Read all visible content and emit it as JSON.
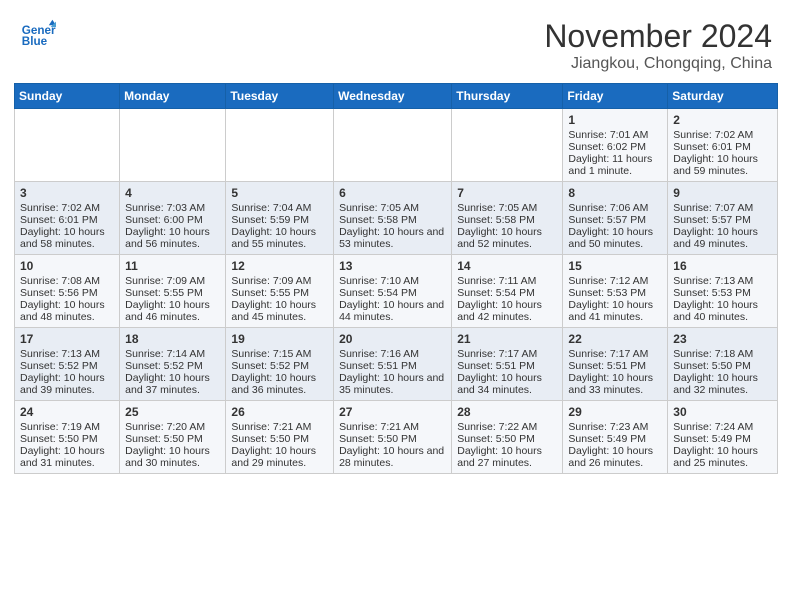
{
  "header": {
    "logo_line1": "General",
    "logo_line2": "Blue",
    "title": "November 2024",
    "subtitle": "Jiangkou, Chongqing, China"
  },
  "weekdays": [
    "Sunday",
    "Monday",
    "Tuesday",
    "Wednesday",
    "Thursday",
    "Friday",
    "Saturday"
  ],
  "weeks": [
    [
      {
        "day": "",
        "sunrise": "",
        "sunset": "",
        "daylight": ""
      },
      {
        "day": "",
        "sunrise": "",
        "sunset": "",
        "daylight": ""
      },
      {
        "day": "",
        "sunrise": "",
        "sunset": "",
        "daylight": ""
      },
      {
        "day": "",
        "sunrise": "",
        "sunset": "",
        "daylight": ""
      },
      {
        "day": "",
        "sunrise": "",
        "sunset": "",
        "daylight": ""
      },
      {
        "day": "1",
        "sunrise": "Sunrise: 7:01 AM",
        "sunset": "Sunset: 6:02 PM",
        "daylight": "Daylight: 11 hours and 1 minute."
      },
      {
        "day": "2",
        "sunrise": "Sunrise: 7:02 AM",
        "sunset": "Sunset: 6:01 PM",
        "daylight": "Daylight: 10 hours and 59 minutes."
      }
    ],
    [
      {
        "day": "3",
        "sunrise": "Sunrise: 7:02 AM",
        "sunset": "Sunset: 6:01 PM",
        "daylight": "Daylight: 10 hours and 58 minutes."
      },
      {
        "day": "4",
        "sunrise": "Sunrise: 7:03 AM",
        "sunset": "Sunset: 6:00 PM",
        "daylight": "Daylight: 10 hours and 56 minutes."
      },
      {
        "day": "5",
        "sunrise": "Sunrise: 7:04 AM",
        "sunset": "Sunset: 5:59 PM",
        "daylight": "Daylight: 10 hours and 55 minutes."
      },
      {
        "day": "6",
        "sunrise": "Sunrise: 7:05 AM",
        "sunset": "Sunset: 5:58 PM",
        "daylight": "Daylight: 10 hours and 53 minutes."
      },
      {
        "day": "7",
        "sunrise": "Sunrise: 7:05 AM",
        "sunset": "Sunset: 5:58 PM",
        "daylight": "Daylight: 10 hours and 52 minutes."
      },
      {
        "day": "8",
        "sunrise": "Sunrise: 7:06 AM",
        "sunset": "Sunset: 5:57 PM",
        "daylight": "Daylight: 10 hours and 50 minutes."
      },
      {
        "day": "9",
        "sunrise": "Sunrise: 7:07 AM",
        "sunset": "Sunset: 5:57 PM",
        "daylight": "Daylight: 10 hours and 49 minutes."
      }
    ],
    [
      {
        "day": "10",
        "sunrise": "Sunrise: 7:08 AM",
        "sunset": "Sunset: 5:56 PM",
        "daylight": "Daylight: 10 hours and 48 minutes."
      },
      {
        "day": "11",
        "sunrise": "Sunrise: 7:09 AM",
        "sunset": "Sunset: 5:55 PM",
        "daylight": "Daylight: 10 hours and 46 minutes."
      },
      {
        "day": "12",
        "sunrise": "Sunrise: 7:09 AM",
        "sunset": "Sunset: 5:55 PM",
        "daylight": "Daylight: 10 hours and 45 minutes."
      },
      {
        "day": "13",
        "sunrise": "Sunrise: 7:10 AM",
        "sunset": "Sunset: 5:54 PM",
        "daylight": "Daylight: 10 hours and 44 minutes."
      },
      {
        "day": "14",
        "sunrise": "Sunrise: 7:11 AM",
        "sunset": "Sunset: 5:54 PM",
        "daylight": "Daylight: 10 hours and 42 minutes."
      },
      {
        "day": "15",
        "sunrise": "Sunrise: 7:12 AM",
        "sunset": "Sunset: 5:53 PM",
        "daylight": "Daylight: 10 hours and 41 minutes."
      },
      {
        "day": "16",
        "sunrise": "Sunrise: 7:13 AM",
        "sunset": "Sunset: 5:53 PM",
        "daylight": "Daylight: 10 hours and 40 minutes."
      }
    ],
    [
      {
        "day": "17",
        "sunrise": "Sunrise: 7:13 AM",
        "sunset": "Sunset: 5:52 PM",
        "daylight": "Daylight: 10 hours and 39 minutes."
      },
      {
        "day": "18",
        "sunrise": "Sunrise: 7:14 AM",
        "sunset": "Sunset: 5:52 PM",
        "daylight": "Daylight: 10 hours and 37 minutes."
      },
      {
        "day": "19",
        "sunrise": "Sunrise: 7:15 AM",
        "sunset": "Sunset: 5:52 PM",
        "daylight": "Daylight: 10 hours and 36 minutes."
      },
      {
        "day": "20",
        "sunrise": "Sunrise: 7:16 AM",
        "sunset": "Sunset: 5:51 PM",
        "daylight": "Daylight: 10 hours and 35 minutes."
      },
      {
        "day": "21",
        "sunrise": "Sunrise: 7:17 AM",
        "sunset": "Sunset: 5:51 PM",
        "daylight": "Daylight: 10 hours and 34 minutes."
      },
      {
        "day": "22",
        "sunrise": "Sunrise: 7:17 AM",
        "sunset": "Sunset: 5:51 PM",
        "daylight": "Daylight: 10 hours and 33 minutes."
      },
      {
        "day": "23",
        "sunrise": "Sunrise: 7:18 AM",
        "sunset": "Sunset: 5:50 PM",
        "daylight": "Daylight: 10 hours and 32 minutes."
      }
    ],
    [
      {
        "day": "24",
        "sunrise": "Sunrise: 7:19 AM",
        "sunset": "Sunset: 5:50 PM",
        "daylight": "Daylight: 10 hours and 31 minutes."
      },
      {
        "day": "25",
        "sunrise": "Sunrise: 7:20 AM",
        "sunset": "Sunset: 5:50 PM",
        "daylight": "Daylight: 10 hours and 30 minutes."
      },
      {
        "day": "26",
        "sunrise": "Sunrise: 7:21 AM",
        "sunset": "Sunset: 5:50 PM",
        "daylight": "Daylight: 10 hours and 29 minutes."
      },
      {
        "day": "27",
        "sunrise": "Sunrise: 7:21 AM",
        "sunset": "Sunset: 5:50 PM",
        "daylight": "Daylight: 10 hours and 28 minutes."
      },
      {
        "day": "28",
        "sunrise": "Sunrise: 7:22 AM",
        "sunset": "Sunset: 5:50 PM",
        "daylight": "Daylight: 10 hours and 27 minutes."
      },
      {
        "day": "29",
        "sunrise": "Sunrise: 7:23 AM",
        "sunset": "Sunset: 5:49 PM",
        "daylight": "Daylight: 10 hours and 26 minutes."
      },
      {
        "day": "30",
        "sunrise": "Sunrise: 7:24 AM",
        "sunset": "Sunset: 5:49 PM",
        "daylight": "Daylight: 10 hours and 25 minutes."
      }
    ]
  ]
}
